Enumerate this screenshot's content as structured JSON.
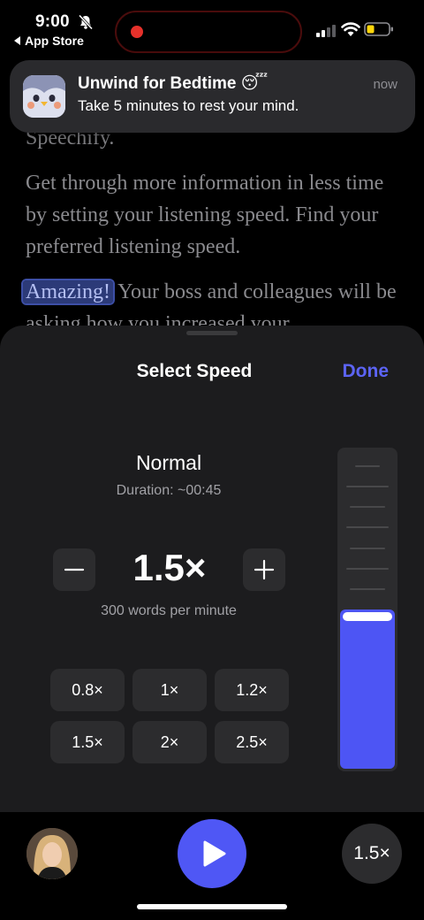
{
  "status_bar": {
    "time": "9:00",
    "back_label": "App Store",
    "icons": [
      "bell-slash-icon",
      "cellular-signal-icon",
      "wifi-icon",
      "battery-low-icon"
    ],
    "recording": true
  },
  "article": {
    "line_partial": "Speechify.",
    "paragraph2": "Get through more information in less time by setting your listening speed. Find your preferred listening speed.",
    "highlight_word": "Amazing!",
    "paragraph3_rest": " Your boss and colleagues will be asking how you increased your"
  },
  "notification": {
    "title": "Unwind for Bedtime 😴",
    "body": "Take 5 minutes to rest your mind.",
    "time": "now",
    "icon": "app-mascot-icon"
  },
  "speed_sheet": {
    "title": "Select Speed",
    "done_label": "Done",
    "speed_name": "Normal",
    "duration": "Duration: ~00:45",
    "current_speed": "1.5×",
    "words_per_minute": "300 words per minute",
    "presets": [
      "0.8×",
      "1×",
      "1.2×",
      "1.5×",
      "2×",
      "2.5×"
    ],
    "slider_level": 0.5
  },
  "player": {
    "speed_badge": "1.5×",
    "accent": "#4f57f5"
  },
  "colors": {
    "accent": "#5c64f5",
    "sheet_bg": "#1c1c1e",
    "button_bg": "#2c2c2e"
  }
}
